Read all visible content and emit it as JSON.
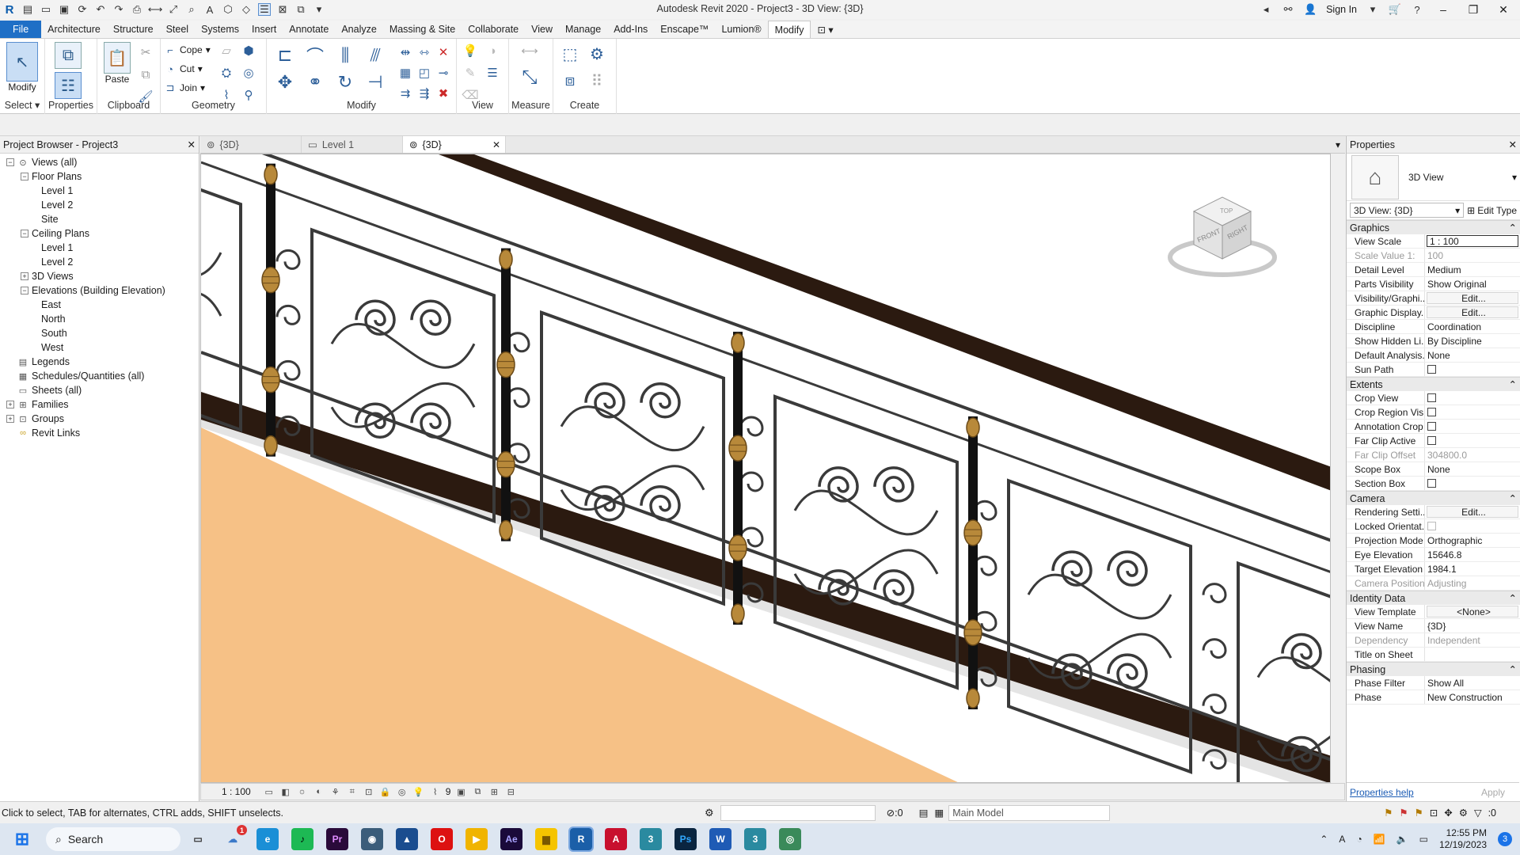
{
  "window": {
    "title": "Autodesk Revit 2020 - Project3 - 3D View: {3D}",
    "sign_in": "Sign In",
    "minimize": "–",
    "maximize": "❐",
    "close": "✕"
  },
  "ribbon_tabs": [
    "File",
    "Architecture",
    "Structure",
    "Steel",
    "Systems",
    "Insert",
    "Annotate",
    "Analyze",
    "Massing & Site",
    "Collaborate",
    "View",
    "Manage",
    "Add-Ins",
    "Enscape™",
    "Lumion®",
    "Modify"
  ],
  "ribbon": {
    "select": {
      "modify_label": "Modify",
      "panel_label": "Select ▾"
    },
    "properties": {
      "label": "Properties"
    },
    "clipboard": {
      "paste_label": "Paste",
      "panel_label": "Clipboard"
    },
    "geometry": {
      "cope": "Cope",
      "cut": "Cut",
      "join": "Join",
      "panel_label": "Geometry"
    },
    "modify": {
      "panel_label": "Modify"
    },
    "view": {
      "panel_label": "View"
    },
    "measure": {
      "panel_label": "Measure"
    },
    "create": {
      "panel_label": "Create"
    }
  },
  "project_browser": {
    "title": "Project Browser - Project3",
    "items": [
      {
        "label": "Views (all)",
        "depth": 0,
        "toggle": "−",
        "icon": "views-icon"
      },
      {
        "label": "Floor Plans",
        "depth": 1,
        "toggle": "−"
      },
      {
        "label": "Level 1",
        "depth": 2
      },
      {
        "label": "Level 2",
        "depth": 2
      },
      {
        "label": "Site",
        "depth": 2
      },
      {
        "label": "Ceiling Plans",
        "depth": 1,
        "toggle": "−"
      },
      {
        "label": "Level 1",
        "depth": 2
      },
      {
        "label": "Level 2",
        "depth": 2
      },
      {
        "label": "3D Views",
        "depth": 1,
        "toggle": "+"
      },
      {
        "label": "Elevations (Building Elevation)",
        "depth": 1,
        "toggle": "−"
      },
      {
        "label": "East",
        "depth": 2
      },
      {
        "label": "North",
        "depth": 2
      },
      {
        "label": "South",
        "depth": 2
      },
      {
        "label": "West",
        "depth": 2
      },
      {
        "label": "Legends",
        "depth": 0,
        "icon": "legend-icon"
      },
      {
        "label": "Schedules/Quantities (all)",
        "depth": 0,
        "icon": "schedule-icon"
      },
      {
        "label": "Sheets (all)",
        "depth": 0,
        "icon": "sheet-icon"
      },
      {
        "label": "Families",
        "depth": 0,
        "toggle": "+",
        "icon": "families-icon"
      },
      {
        "label": "Groups",
        "depth": 0,
        "toggle": "+",
        "icon": "groups-icon"
      },
      {
        "label": "Revit Links",
        "depth": 0,
        "icon": "link-icon"
      }
    ]
  },
  "view_tabs": [
    {
      "label": "{3D}",
      "active": false
    },
    {
      "label": "Level 1",
      "active": false
    },
    {
      "label": "{3D}",
      "active": true
    }
  ],
  "viewcube": {
    "top": "TOP",
    "front": "FRONT",
    "right": "RIGHT"
  },
  "view_control_bar": {
    "scale": "1 : 100",
    "count": "9"
  },
  "properties": {
    "title": "Properties",
    "type_name": "3D View",
    "selector": "3D View: {3D}",
    "edit_type": "Edit Type",
    "groups": [
      {
        "name": "Graphics",
        "rows": [
          {
            "name": "View Scale",
            "value": "1 : 100",
            "style": "boxed"
          },
          {
            "name": "Scale Value    1:",
            "value": "100",
            "style": "disabled"
          },
          {
            "name": "Detail Level",
            "value": "Medium"
          },
          {
            "name": "Parts Visibility",
            "value": "Show Original"
          },
          {
            "name": "Visibility/Graphi...",
            "value": "Edit...",
            "style": "button"
          },
          {
            "name": "Graphic Display...",
            "value": "Edit...",
            "style": "button"
          },
          {
            "name": "Discipline",
            "value": "Coordination"
          },
          {
            "name": "Show Hidden Li...",
            "value": "By Discipline"
          },
          {
            "name": "Default Analysis...",
            "value": "None"
          },
          {
            "name": "Sun Path",
            "value": "",
            "style": "checkbox"
          }
        ]
      },
      {
        "name": "Extents",
        "rows": [
          {
            "name": "Crop View",
            "value": "",
            "style": "checkbox"
          },
          {
            "name": "Crop Region Vis...",
            "value": "",
            "style": "checkbox"
          },
          {
            "name": "Annotation Crop",
            "value": "",
            "style": "checkbox"
          },
          {
            "name": "Far Clip Active",
            "value": "",
            "style": "checkbox"
          },
          {
            "name": "Far Clip Offset",
            "value": "304800.0",
            "style": "disabled"
          },
          {
            "name": "Scope Box",
            "value": "None"
          },
          {
            "name": "Section Box",
            "value": "",
            "style": "checkbox"
          }
        ]
      },
      {
        "name": "Camera",
        "rows": [
          {
            "name": "Rendering Setti...",
            "value": "Edit...",
            "style": "button"
          },
          {
            "name": "Locked Orientat...",
            "value": "",
            "style": "checkbox-disabled"
          },
          {
            "name": "Projection Mode",
            "value": "Orthographic"
          },
          {
            "name": "Eye Elevation",
            "value": "15646.8"
          },
          {
            "name": "Target Elevation",
            "value": "1984.1"
          },
          {
            "name": "Camera Position",
            "value": "Adjusting",
            "style": "disabled"
          }
        ]
      },
      {
        "name": "Identity Data",
        "rows": [
          {
            "name": "View Template",
            "value": "<None>",
            "style": "button"
          },
          {
            "name": "View Name",
            "value": "{3D}"
          },
          {
            "name": "Dependency",
            "value": "Independent",
            "style": "disabled"
          },
          {
            "name": "Title on Sheet",
            "value": ""
          }
        ]
      },
      {
        "name": "Phasing",
        "rows": [
          {
            "name": "Phase Filter",
            "value": "Show All"
          },
          {
            "name": "Phase",
            "value": "New Construction"
          }
        ]
      }
    ],
    "help_link": "Properties help",
    "apply": "Apply"
  },
  "statusbar": {
    "hint": "Click to select, TAB for alternates, CTRL adds, SHIFT unselects.",
    "zero": ":0",
    "model": "Main Model",
    "filter_count": ":0"
  },
  "taskbar": {
    "search": "Search",
    "time": "12:55 PM",
    "date": "12/19/2023",
    "notification_count": "3",
    "badge": "1",
    "apps": [
      "edge",
      "spotify",
      "premiere",
      "lumion",
      "sketchup",
      "opera",
      "media",
      "after-effects",
      "explorer",
      "revit",
      "autocad",
      "3dsmax",
      "photoshop",
      "word",
      "3dsmax-2",
      "browser"
    ]
  },
  "colors": {
    "rail": "#2b1a10",
    "iron": "#3a3a3a",
    "floor": "#f6c186",
    "brass": "#b8893a",
    "accent": "#1f6fc6"
  }
}
